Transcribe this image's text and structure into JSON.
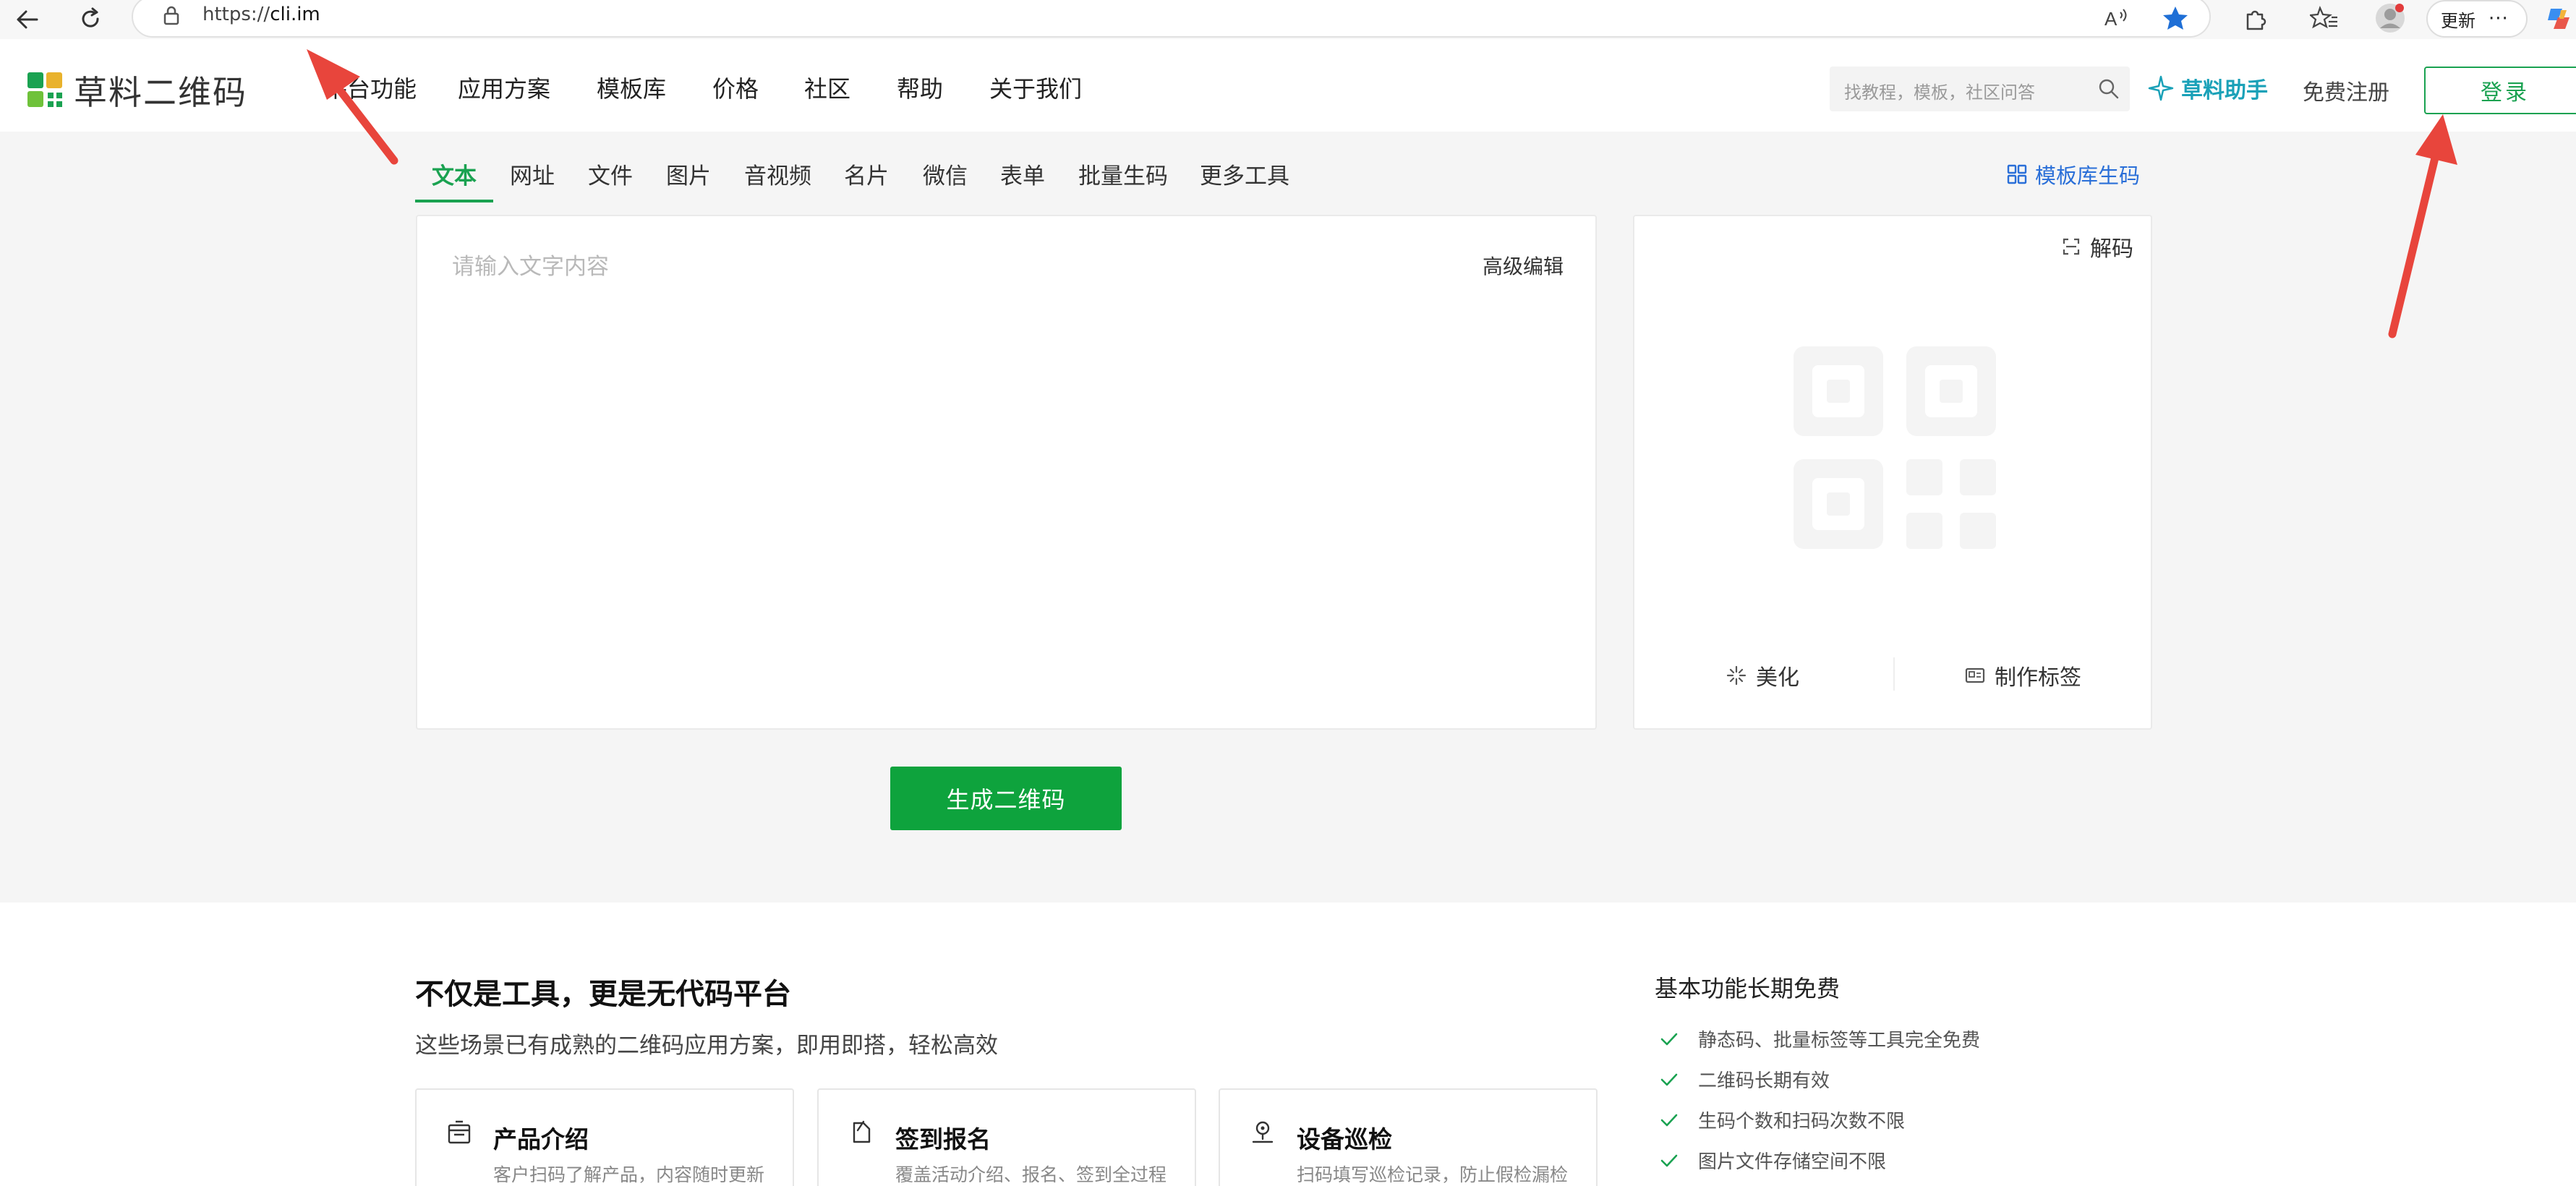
{
  "browser": {
    "url_scheme": "https://",
    "url_host": "cli.im",
    "update_label": "更新",
    "more_label": "···"
  },
  "header": {
    "logo_text": "草料二维码",
    "nav": [
      "平台功能",
      "应用方案",
      "模板库",
      "价格",
      "社区",
      "帮助",
      "关于我们"
    ],
    "search_placeholder": "找教程，模板，社区问答",
    "assistant_label": "草料助手",
    "register_label": "免费注册",
    "login_label": "登录"
  },
  "tabs": [
    "文本",
    "网址",
    "文件",
    "图片",
    "音视频",
    "名片",
    "微信",
    "表单",
    "批量生码",
    "更多工具"
  ],
  "active_tab": "文本",
  "template_gen_label": "模板库生码",
  "editor": {
    "placeholder": "请输入文字内容",
    "advanced_label": "高级编辑"
  },
  "qr_panel": {
    "decode_label": "解码",
    "beautify_label": "美化",
    "label_maker_label": "制作标签"
  },
  "generate_button": "生成二维码",
  "promo": {
    "title": "不仅是工具，更是无代码平台",
    "subtitle": "这些场景已有成熟的二维码应用方案，即用即搭，轻松高效",
    "cards": [
      {
        "title": "产品介绍",
        "desc": "客户扫码了解产品，内容随时更新"
      },
      {
        "title": "签到报名",
        "desc": "覆盖活动介绍、报名、签到全过程"
      },
      {
        "title": "设备巡检",
        "desc": "扫码填写巡检记录，防止假检漏检"
      }
    ]
  },
  "free_features": {
    "title": "基本功能长期免费",
    "items": [
      "静态码、批量标签等工具完全免费",
      "二维码长期有效",
      "生码个数和扫码次数不限",
      "图片文件存储空间不限"
    ]
  },
  "colors": {
    "brand_green": "#1aa251",
    "button_green": "#0ea33d",
    "link_blue": "#2a6fd8",
    "assistant_teal": "#1aa1b8",
    "annotation_red": "#e8453c"
  }
}
